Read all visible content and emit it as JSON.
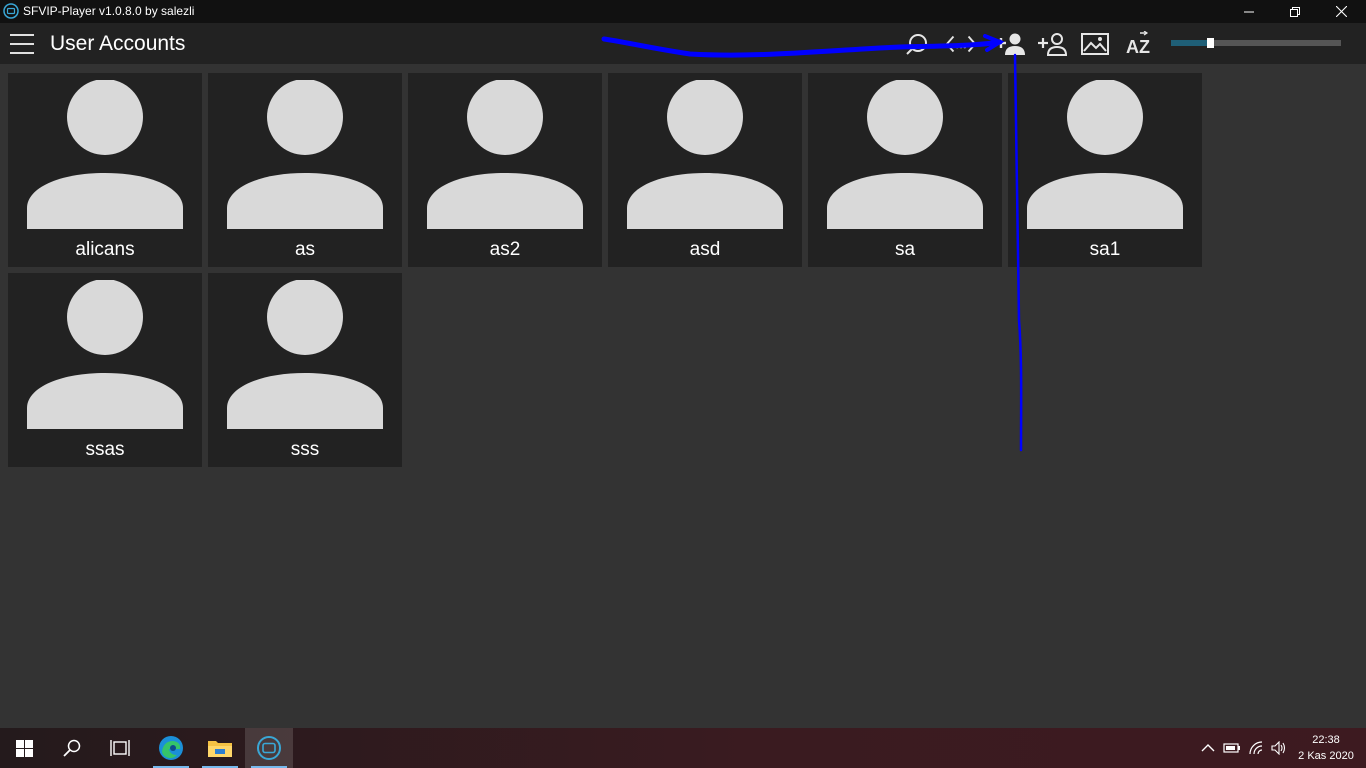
{
  "window": {
    "title": "SFVIP-Player v1.0.8.0 by salezli",
    "controls": [
      "minimize",
      "restore",
      "close"
    ]
  },
  "header": {
    "menu_icon": "hamburger-menu-icon",
    "title": "User Accounts",
    "toolbar_icons": [
      "search-icon",
      "code-edit-icon",
      "add-user-icon",
      "add-user-outline-icon",
      "image-icon",
      "sort-az-icon"
    ],
    "sort_label": "AZ",
    "zoom_slider_value": 0.23
  },
  "accounts": [
    {
      "name": "alicans"
    },
    {
      "name": "as"
    },
    {
      "name": "as2"
    },
    {
      "name": "asd"
    },
    {
      "name": "sa"
    },
    {
      "name": "sa1"
    },
    {
      "name": "ssas"
    },
    {
      "name": "sss"
    }
  ],
  "annotation": {
    "color": "#0000ff"
  },
  "taskbar": {
    "items": [
      "windows-start-icon",
      "search-icon",
      "task-view-icon",
      "edge-browser-icon",
      "file-explorer-icon",
      "sfvip-player-icon"
    ],
    "tray": [
      "chevron-up-icon",
      "battery-icon",
      "wifi-icon",
      "volume-icon"
    ],
    "time": "22:38",
    "date": "2 Kas 2020"
  },
  "colors": {
    "background": "#333333",
    "header": "#222222",
    "card": "#222222",
    "avatar": "#d9d9d9",
    "accent": "#1f5f77"
  }
}
